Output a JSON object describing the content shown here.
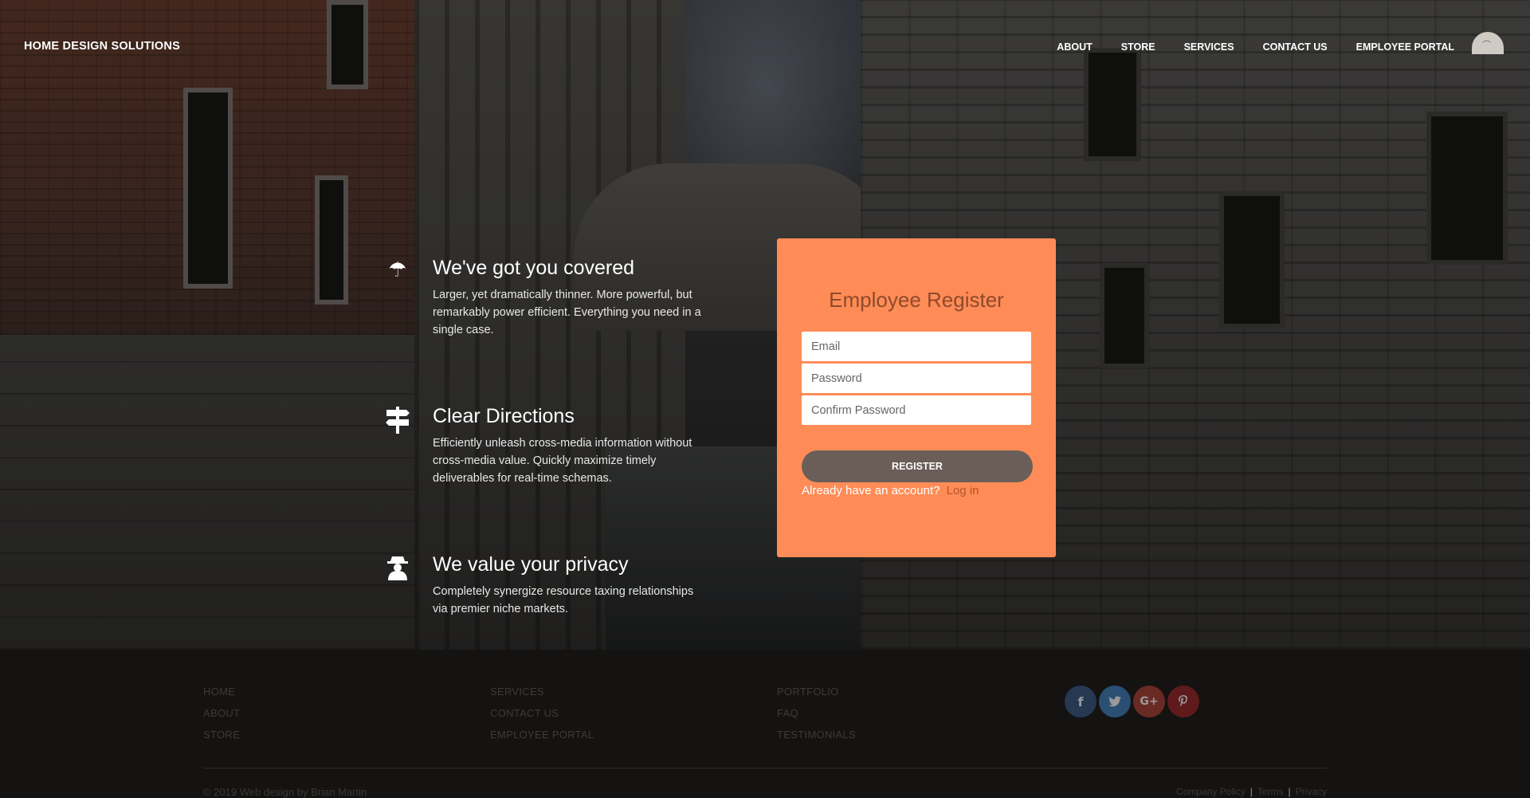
{
  "brand": "HOME DESIGN SOLUTIONS",
  "nav": {
    "items": [
      {
        "label": "ABOUT"
      },
      {
        "label": "STORE"
      },
      {
        "label": "SERVICES"
      },
      {
        "label": "CONTACT US"
      },
      {
        "label": "EMPLOYEE PORTAL"
      }
    ]
  },
  "features": [
    {
      "icon": "umbrella-icon",
      "title": "We've got you covered",
      "desc": "Larger, yet dramatically thinner. More powerful, but remarkably power efficient. Everything you need in a single case."
    },
    {
      "icon": "signpost-icon",
      "title": "Clear Directions",
      "desc": "Efficiently unleash cross-media information without cross-media value. Quickly maximize timely deliverables for real-time schemas."
    },
    {
      "icon": "spy-icon",
      "title": "We value your privacy",
      "desc": "Completely synergize resource taxing relationships via premier niche markets."
    }
  ],
  "register": {
    "title": "Employee Register",
    "email_placeholder": "Email",
    "password_placeholder": "Password",
    "confirm_placeholder": "Confirm Password",
    "button_label": "REGISTER",
    "already_text": "Already have an account?",
    "login_label": "Log in"
  },
  "footer": {
    "col1": [
      "HOME",
      "ABOUT",
      "STORE"
    ],
    "col2": [
      "SERVICES",
      "CONTACT US",
      "EMPLOYEE PORTAL"
    ],
    "col3": [
      "PORTFOLIO",
      "FAQ",
      "TESTIMONIALS"
    ],
    "social": [
      {
        "icon": "facebook-icon",
        "glyph": "f",
        "color": "#3b5998"
      },
      {
        "icon": "twitter-icon",
        "glyph": "t",
        "color": "#1da1f2"
      },
      {
        "icon": "google-plus-icon",
        "glyph": "G+",
        "color": "#dd4b39"
      },
      {
        "icon": "pinterest-icon",
        "glyph": "P",
        "color": "#cb2027"
      }
    ],
    "copyright": "© 2019 Web design by Brian Martin",
    "legal": [
      "Company Policy",
      "Terms",
      "Privacy"
    ]
  },
  "colors": {
    "card": "#ff8c57",
    "card_title": "#8e4a2b",
    "register_button": "#6b5e58",
    "login_link": "#b4532a",
    "footer_bg": "#141311"
  }
}
